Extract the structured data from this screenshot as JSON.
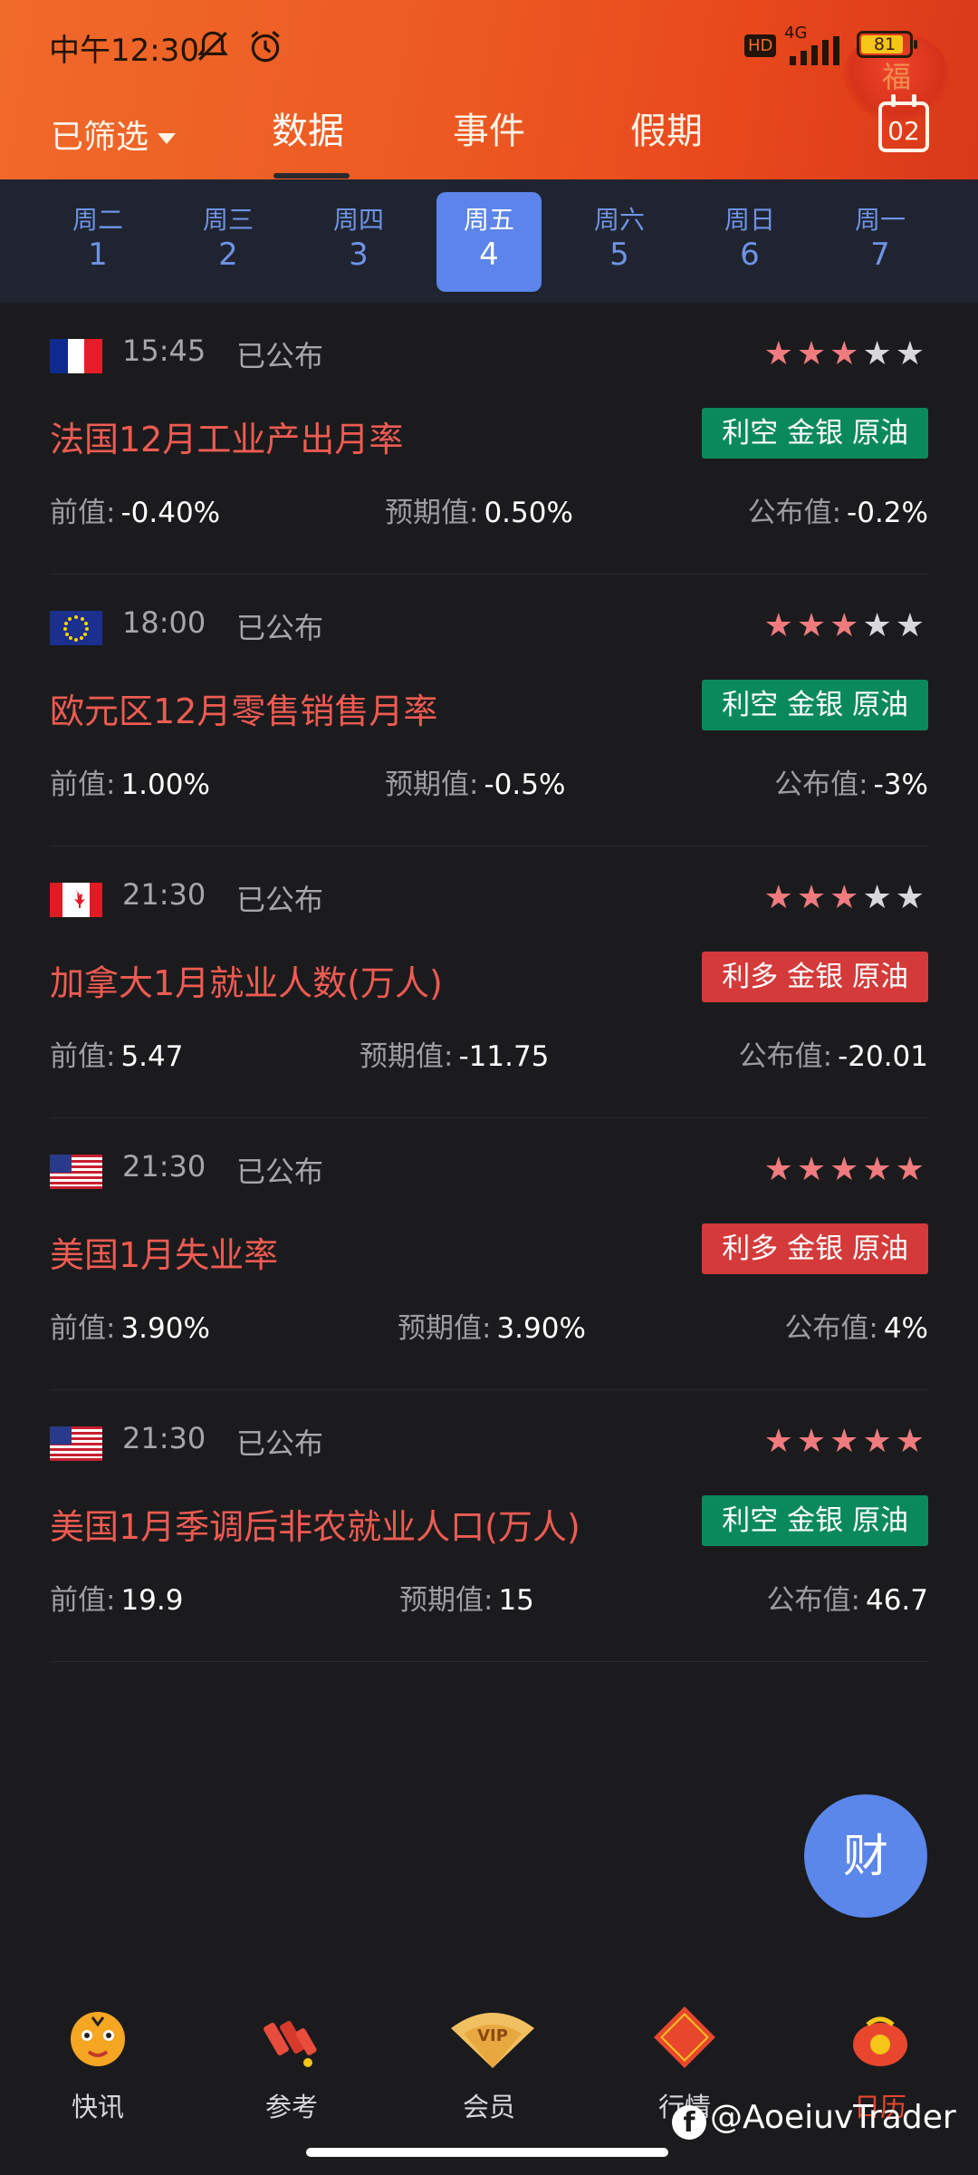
{
  "status": {
    "time": "中午12:30",
    "hd": "HD",
    "network": "4G",
    "battery": "81"
  },
  "header": {
    "filter_label": "已筛选",
    "tabs": [
      "数据",
      "事件",
      "假期"
    ],
    "calendar_day": "02",
    "deco_text": "福"
  },
  "week": [
    {
      "wd": "周二",
      "dn": "1"
    },
    {
      "wd": "周三",
      "dn": "2"
    },
    {
      "wd": "周四",
      "dn": "3"
    },
    {
      "wd": "周五",
      "dn": "4"
    },
    {
      "wd": "周六",
      "dn": "5"
    },
    {
      "wd": "周日",
      "dn": "6"
    },
    {
      "wd": "周一",
      "dn": "7"
    }
  ],
  "events": [
    {
      "country": "france",
      "time": "15:45",
      "status": "已公布",
      "stars": 3,
      "title": "法国12月工业产出月率",
      "impact": "利空 金银 原油",
      "impact_color": "#0a8a5c",
      "prev_label": "前值:",
      "prev": "-0.40%",
      "fc_label": "预期值:",
      "fc": "0.50%",
      "act_label": "公布值:",
      "act": "-0.2%"
    },
    {
      "country": "eu",
      "time": "18:00",
      "status": "已公布",
      "stars": 3,
      "title": "欧元区12月零售销售月率",
      "impact": "利空 金银 原油",
      "impact_color": "#0a8a5c",
      "prev_label": "前值:",
      "prev": "1.00%",
      "fc_label": "预期值:",
      "fc": "-0.5%",
      "act_label": "公布值:",
      "act": "-3%"
    },
    {
      "country": "canada",
      "time": "21:30",
      "status": "已公布",
      "stars": 3,
      "title": "加拿大1月就业人数(万人)",
      "impact": "利多 金银 原油",
      "impact_color": "#d43a3a",
      "prev_label": "前值:",
      "prev": "5.47",
      "fc_label": "预期值:",
      "fc": "-11.75",
      "act_label": "公布值:",
      "act": "-20.01"
    },
    {
      "country": "usa",
      "time": "21:30",
      "status": "已公布",
      "stars": 5,
      "title": "美国1月失业率",
      "impact": "利多 金银 原油",
      "impact_color": "#d43a3a",
      "prev_label": "前值:",
      "prev": "3.90%",
      "fc_label": "预期值:",
      "fc": "3.90%",
      "act_label": "公布值:",
      "act": "4%"
    },
    {
      "country": "usa",
      "time": "21:30",
      "status": "已公布",
      "stars": 5,
      "title": "美国1月季调后非农就业人口(万人)",
      "impact": "利空 金银 原油",
      "impact_color": "#0a8a5c",
      "prev_label": "前值:",
      "prev": "19.9",
      "fc_label": "预期值:",
      "fc": "15",
      "act_label": "公布值:",
      "act": "46.7"
    }
  ],
  "fab_label": "财",
  "nav": [
    {
      "label": "快讯",
      "icon": "tiger-icon"
    },
    {
      "label": "参考",
      "icon": "firecracker-icon"
    },
    {
      "label": "会员",
      "icon": "vip-fan-icon"
    },
    {
      "label": "行情",
      "icon": "fa-diamond-icon"
    },
    {
      "label": "日历",
      "icon": "lucky-bag-icon"
    }
  ],
  "watermark": "@AoeiuvTrader"
}
